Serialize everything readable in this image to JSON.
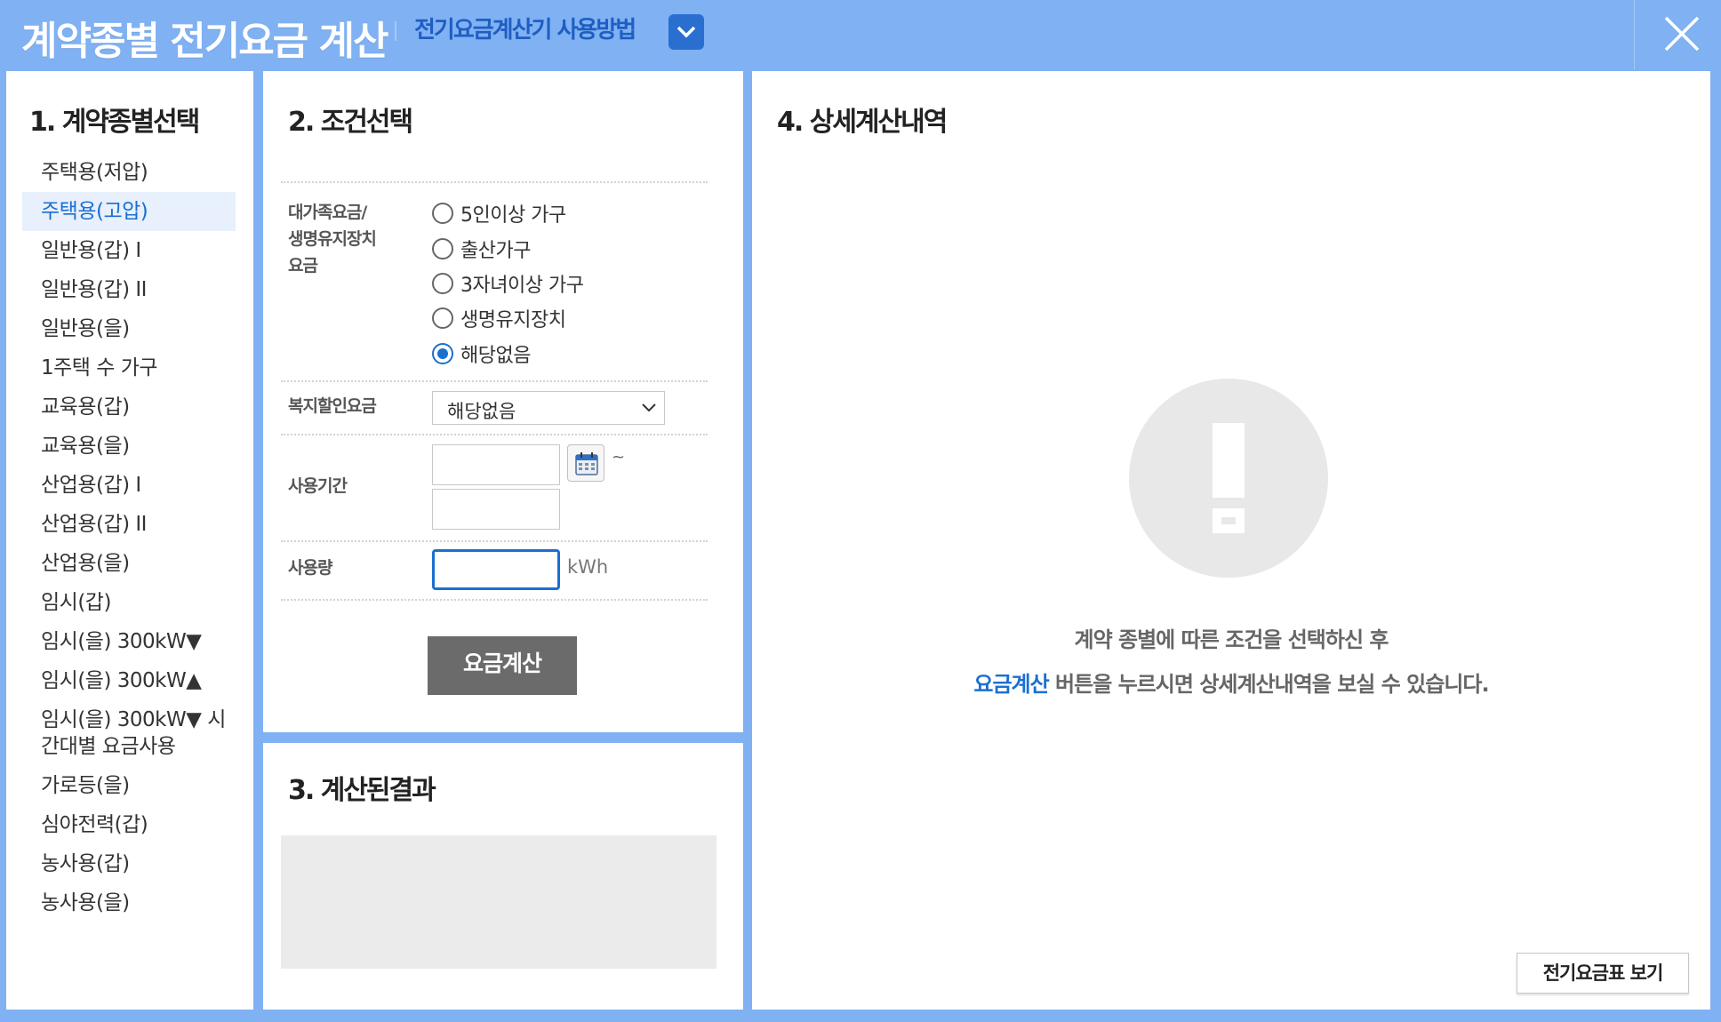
{
  "header": {
    "title": "계약종별 전기요금 계산",
    "help_link": "전기요금계산기 사용방법",
    "help_toggle_icon": "chevron-down-icon",
    "close_icon": "close-icon"
  },
  "panel1": {
    "title": "1. 계약종별선택",
    "items": [
      "주택용(저압)",
      "주택용(고압)",
      "일반용(갑) I",
      "일반용(갑) II",
      "일반용(을)",
      "1주택 수 가구",
      "교육용(갑)",
      "교육용(을)",
      "산업용(갑) I",
      "산업용(갑) II",
      "산업용(을)",
      "임시(갑)",
      "임시(을) 300kW▼",
      "임시(을) 300kW▲",
      "임시(을) 300kW▼ 시간대별 요금사용",
      "가로등(을)",
      "심야전력(갑)",
      "농사용(갑)",
      "농사용(을)"
    ],
    "selected_index": 1
  },
  "panel2": {
    "title": "2. 조건선택",
    "family_label_line1": "대가족요금/",
    "family_label_line2": "생명유지장치",
    "family_label_line3": "요금",
    "family_options": [
      "5인이상 가구",
      "출산가구",
      "3자녀이상 가구",
      "생명유지장치",
      "해당없음"
    ],
    "family_selected": "해당없음",
    "welfare_label": "복지할인요금",
    "welfare_value": "해당없음",
    "period_label": "사용기간",
    "period_start": "",
    "period_end": "",
    "period_separator": "~",
    "calendar_icon": "calendar-icon",
    "usage_label": "사용량",
    "usage_value": "",
    "usage_unit": "kWh",
    "calc_button": "요금계산"
  },
  "panel3": {
    "title": "3. 계산된결과"
  },
  "panel4": {
    "title": "4. 상세계산내역",
    "guide_line1": "계약 종별에 따른 조건을 선택하신 후",
    "guide_highlight": "요금계산",
    "guide_line2_rest": " 버튼을 누르시면 상세계산내역을 보실 수 있습니다.",
    "warning_icon": "exclamation-icon",
    "rate_table_button": "전기요금표 보기"
  },
  "colors": {
    "frame": "#7fb1f3",
    "accent": "#1b6fd1",
    "selected_bg": "#e7f0fc",
    "calc_button_bg": "#6b6b6b"
  }
}
